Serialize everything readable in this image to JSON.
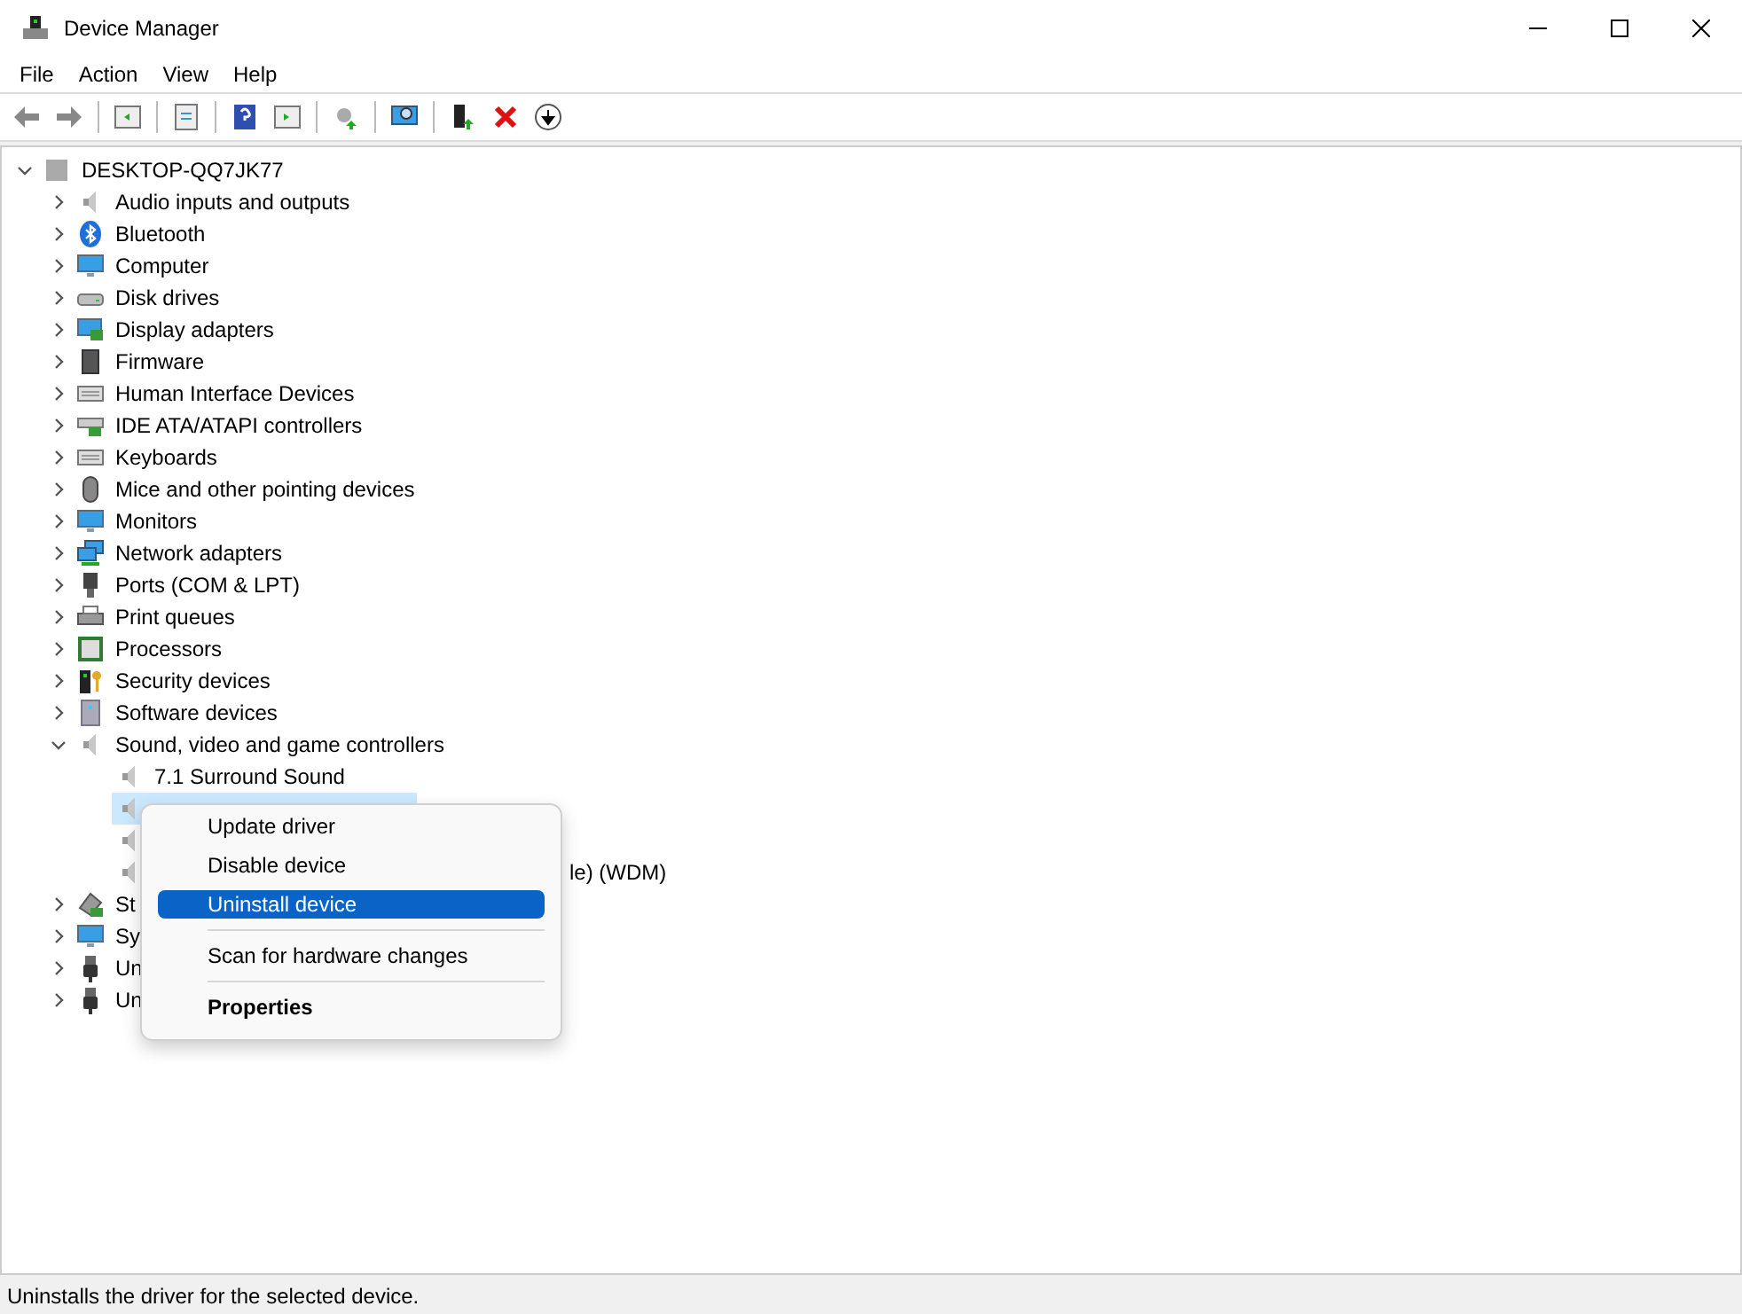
{
  "window": {
    "title": "Device Manager"
  },
  "menu": [
    "File",
    "Action",
    "View",
    "Help"
  ],
  "tree": {
    "label": "DESKTOP-QQ7JK77",
    "expanded": true,
    "children": [
      {
        "label": "Audio inputs and outputs",
        "expanded": false
      },
      {
        "label": "Bluetooth",
        "expanded": false
      },
      {
        "label": "Computer",
        "expanded": false
      },
      {
        "label": "Disk drives",
        "expanded": false
      },
      {
        "label": "Display adapters",
        "expanded": false
      },
      {
        "label": "Firmware",
        "expanded": false
      },
      {
        "label": "Human Interface Devices",
        "expanded": false
      },
      {
        "label": "IDE ATA/ATAPI controllers",
        "expanded": false
      },
      {
        "label": "Keyboards",
        "expanded": false
      },
      {
        "label": "Mice and other pointing devices",
        "expanded": false
      },
      {
        "label": "Monitors",
        "expanded": false
      },
      {
        "label": "Network adapters",
        "expanded": false
      },
      {
        "label": "Ports (COM & LPT)",
        "expanded": false
      },
      {
        "label": "Print queues",
        "expanded": false
      },
      {
        "label": "Processors",
        "expanded": false
      },
      {
        "label": "Security devices",
        "expanded": false
      },
      {
        "label": "Software devices",
        "expanded": false
      },
      {
        "label": "Sound, video and game controllers",
        "expanded": true,
        "children": [
          {
            "label": "7.1 Surround Sound",
            "selected": false
          },
          {
            "selected": true
          },
          {
            "selected": false
          },
          {
            "tail": "le) (WDM)",
            "selected": false
          }
        ]
      },
      {
        "label": "St",
        "expanded": false
      },
      {
        "label": "Sy",
        "expanded": false
      },
      {
        "label": "Un",
        "expanded": false
      },
      {
        "label": "Un",
        "expanded": false
      }
    ]
  },
  "context_menu": {
    "items": [
      {
        "kind": "item",
        "label": "Update driver",
        "selected": false
      },
      {
        "kind": "item",
        "label": "Disable device",
        "selected": false
      },
      {
        "kind": "item",
        "label": "Uninstall device",
        "selected": true
      },
      {
        "kind": "separator"
      },
      {
        "kind": "item",
        "label": "Scan for hardware changes",
        "selected": false
      },
      {
        "kind": "separator"
      },
      {
        "kind": "default",
        "label": "Properties",
        "selected": false
      }
    ]
  },
  "status_bar": "Uninstalls the driver for the selected device."
}
